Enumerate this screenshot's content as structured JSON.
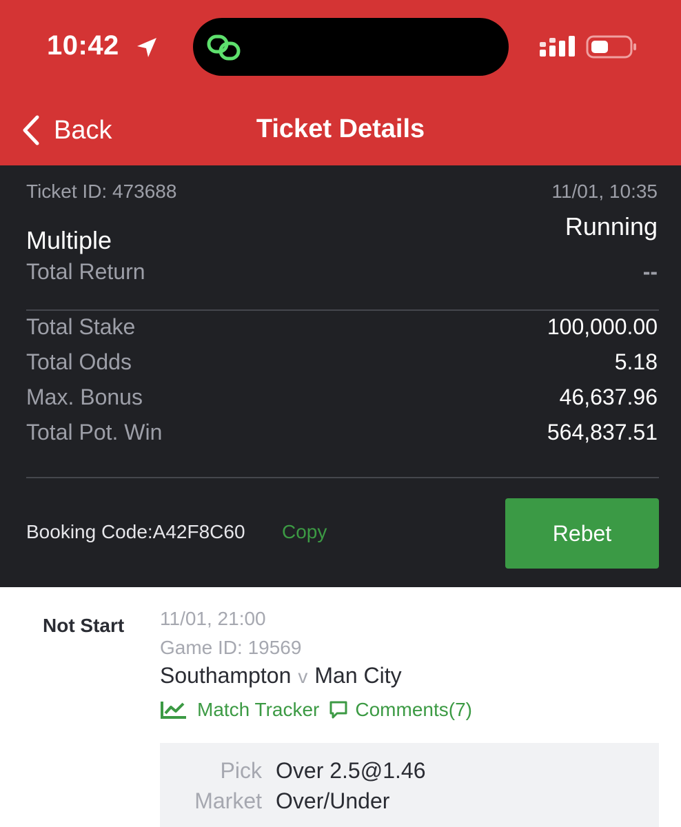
{
  "status_bar": {
    "time": "10:42",
    "icons": [
      "location-arrow-icon",
      "link-icon",
      "signal-icon",
      "battery-icon"
    ]
  },
  "header": {
    "back_label": "Back",
    "title": "Ticket Details",
    "background_color": "#d43434"
  },
  "ticket": {
    "id_text": "Ticket ID: 473688",
    "datetime": "11/01, 10:35",
    "type": "Multiple",
    "status": "Running",
    "total_return_label": "Total Return",
    "total_return_value": "--",
    "stats": [
      {
        "label": "Total Stake",
        "value": "100,000.00"
      },
      {
        "label": "Total Odds",
        "value": "5.18"
      },
      {
        "label": "Max. Bonus",
        "value": "46,637.96"
      },
      {
        "label": "Total Pot. Win",
        "value": "564,837.51"
      }
    ],
    "booking_code_text": "Booking Code:A42F8C60",
    "copy_label": "Copy",
    "rebet_label": "Rebet",
    "accent_color": "#3b9a45"
  },
  "selection": {
    "status": "Not Start",
    "datetime": "11/01, 21:00",
    "game_id_text": "Game ID: 19569",
    "home_team": "Southampton",
    "vs": "v",
    "away_team": "Man City",
    "match_tracker_label": "Match Tracker",
    "comments_label": "Comments(7)",
    "pick_label": "Pick",
    "pick_value": "Over 2.5@1.46",
    "market_label": "Market",
    "market_value": "Over/Under"
  }
}
